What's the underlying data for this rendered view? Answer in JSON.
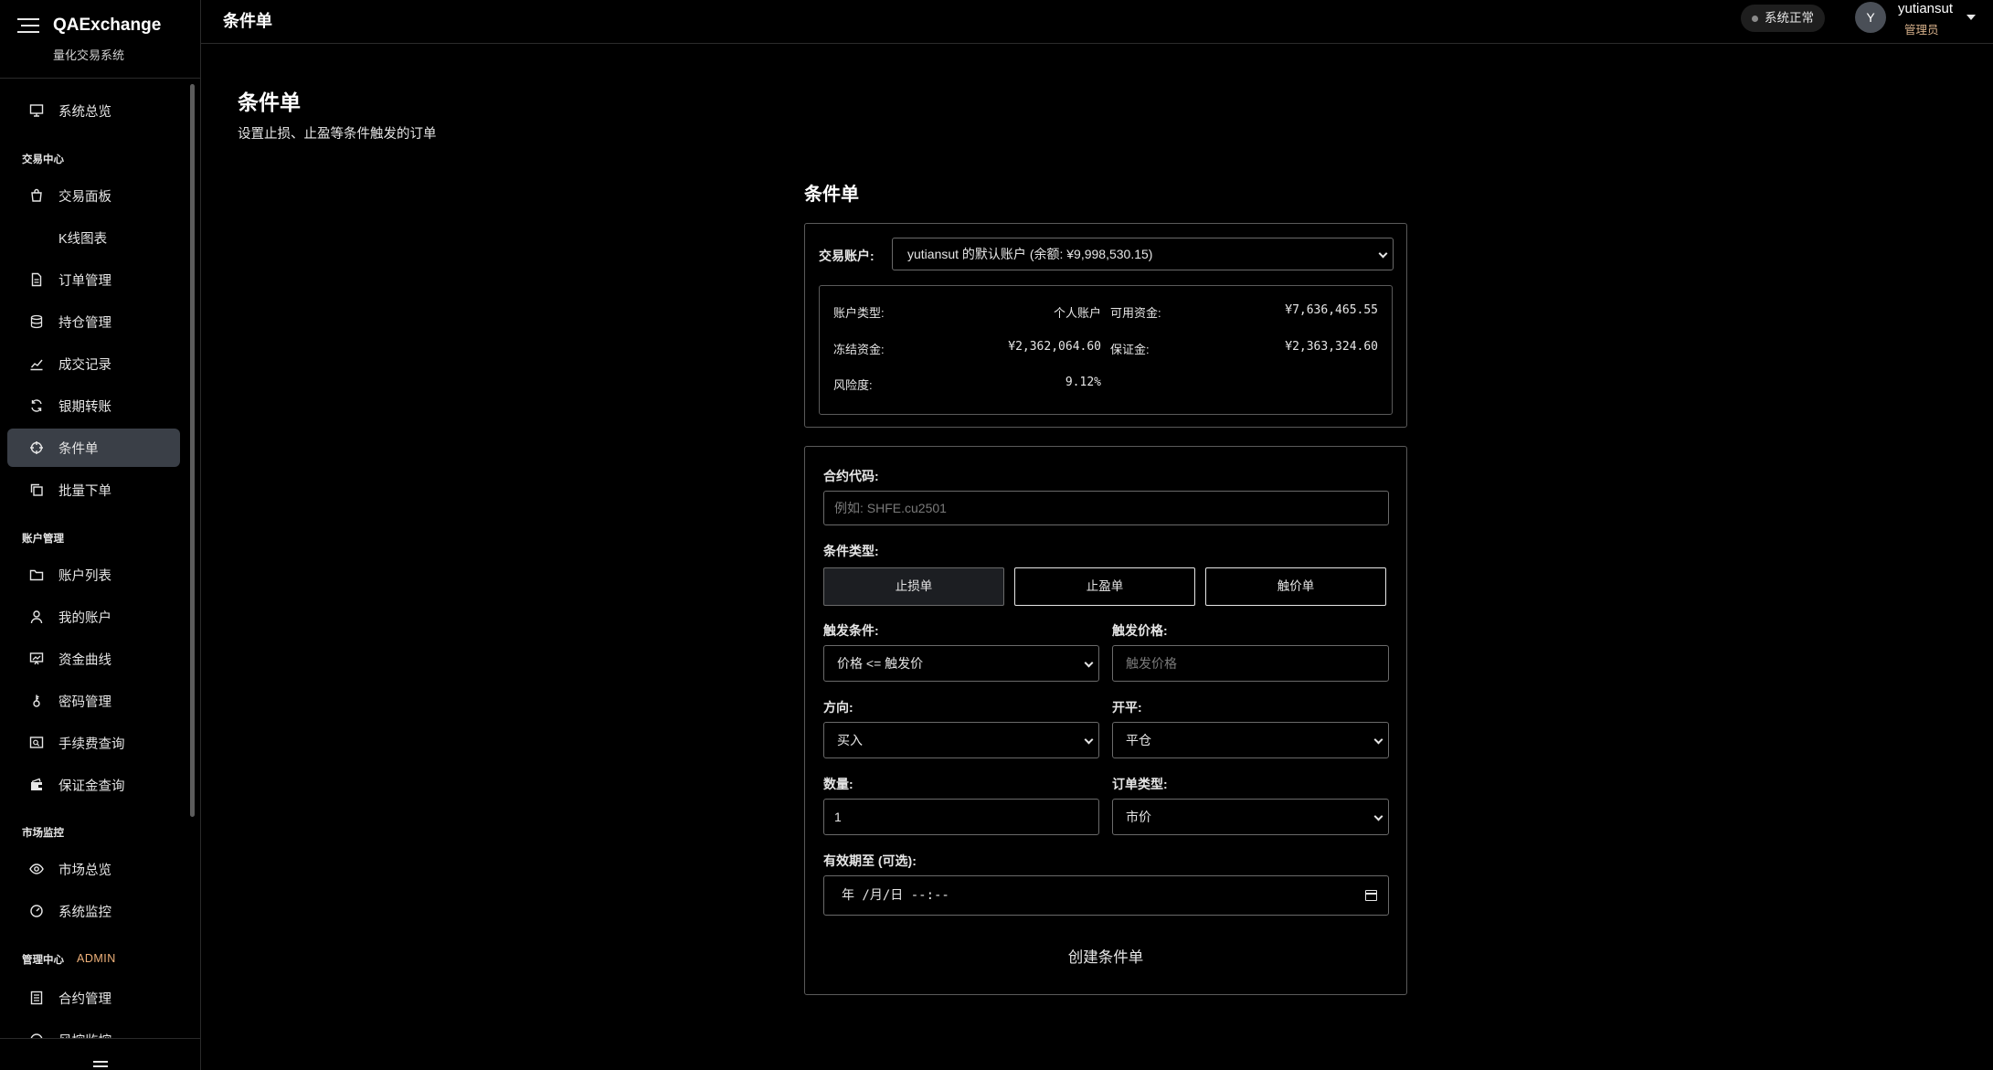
{
  "app": {
    "name": "QAExchange",
    "subtitle": "量化交易系统"
  },
  "header": {
    "title": "条件单",
    "status": "系统正常",
    "user": {
      "initial": "Y",
      "name": "yutiansut",
      "role": "管理员"
    }
  },
  "sidebar": {
    "top_item": "系统总览",
    "sections": {
      "trading": "交易中心",
      "account": "账户管理",
      "market": "市场监控",
      "admin": "管理中心",
      "admin_badge": "ADMIN"
    },
    "items": {
      "trade_panel": "交易面板",
      "kline": "K线图表",
      "orders": "订单管理",
      "positions": "持仓管理",
      "trades": "成交记录",
      "transfer": "银期转账",
      "conditional": "条件单",
      "batch": "批量下单",
      "account_list": "账户列表",
      "my_account": "我的账户",
      "equity_curve": "资金曲线",
      "password": "密码管理",
      "fees": "手续费查询",
      "margin": "保证金查询",
      "market_overview": "市场总览",
      "system_monitor": "系统监控",
      "contracts": "合约管理",
      "risk_monitor": "风控监控"
    }
  },
  "page": {
    "title": "条件单",
    "subtitle": "设置止损、止盈等条件触发的订单"
  },
  "form": {
    "heading": "条件单",
    "account_label": "交易账户:",
    "account_value": "yutiansut 的默认账户 (余额: ¥9,998,530.15)",
    "info": {
      "type_key": "账户类型:",
      "type_val": "个人账户",
      "available_key": "可用资金:",
      "available_val": "¥7,636,465.55",
      "frozen_key": "冻结资金:",
      "frozen_val": "¥2,362,064.60",
      "margin_key": "保证金:",
      "margin_val": "¥2,363,324.60",
      "risk_key": "风险度:",
      "risk_val": "9.12%"
    },
    "contract_label": "合约代码:",
    "contract_placeholder": "例如: SHFE.cu2501",
    "condition_type_label": "条件类型:",
    "condition_types": [
      "止损单",
      "止盈单",
      "触价单"
    ],
    "condition_types_selected": "止损单",
    "trigger_condition_label": "触发条件:",
    "trigger_condition_value": "价格 <= 触发价",
    "trigger_price_label": "触发价格:",
    "trigger_price_placeholder": "触发价格",
    "direction_label": "方向:",
    "direction_value": "买入",
    "offset_label": "开平:",
    "offset_value": "平仓",
    "quantity_label": "数量:",
    "quantity_value": "1",
    "order_type_label": "订单类型:",
    "order_type_value": "市价",
    "expiry_label": "有效期至 (可选):",
    "expiry_value": "年 /月/日 --:--",
    "submit_label": "创建条件单"
  }
}
